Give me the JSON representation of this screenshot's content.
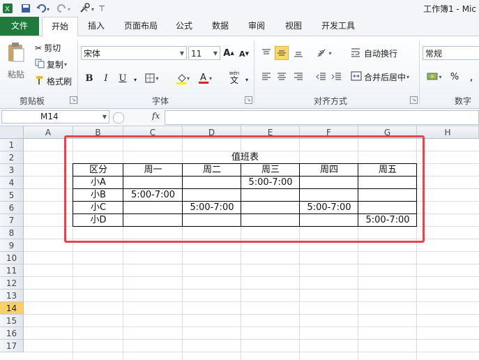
{
  "window": {
    "title": "工作簿1 - Mic"
  },
  "tabs": {
    "file": "文件",
    "home": "开始",
    "insert": "插入",
    "layout": "页面布局",
    "formulas": "公式",
    "data": "数据",
    "review": "审阅",
    "view": "视图",
    "developer": "开发工具"
  },
  "clipboard": {
    "paste": "粘贴",
    "cut": "剪切",
    "copy": "复制",
    "format_painter": "格式刷",
    "group": "剪贴板"
  },
  "font": {
    "name": "宋体",
    "size": "11",
    "bold": "B",
    "italic": "I",
    "underline": "U",
    "grow": "A",
    "shrink": "A",
    "group": "字体",
    "wen": "wén",
    "wen_char": "文"
  },
  "alignment": {
    "wrap": "自动换行",
    "merge": "合并后居中",
    "group": "对齐方式"
  },
  "number": {
    "format": "常规",
    "percent": "%",
    "group": "数字"
  },
  "formula_bar": {
    "name_box": "M14",
    "fx": "fx"
  },
  "columns": [
    "A",
    "B",
    "C",
    "D",
    "E",
    "F",
    "G",
    "H"
  ],
  "rows": [
    "1",
    "2",
    "3",
    "4",
    "5",
    "6",
    "7",
    "8",
    "9",
    "10",
    "11",
    "12",
    "13",
    "14",
    "15",
    "16",
    "17"
  ],
  "active_row": "14",
  "sheet": {
    "title": "值班表",
    "headers": [
      "区分",
      "周一",
      "周二",
      "周三",
      "周四",
      "周五"
    ],
    "rows": [
      [
        "小A",
        "",
        "",
        "5:00-7:00",
        "",
        ""
      ],
      [
        "小B",
        "5:00-7:00",
        "",
        "",
        "",
        ""
      ],
      [
        "小C",
        "",
        "5:00-7:00",
        "",
        "5:00-7:00",
        ""
      ],
      [
        "小D",
        "",
        "",
        "",
        "",
        "5:00-7:00"
      ]
    ]
  },
  "colors": {
    "file_tab": "#1f7a3c",
    "highlight_frame": "#e0484d",
    "active_row_header": "#f9cf6b"
  }
}
